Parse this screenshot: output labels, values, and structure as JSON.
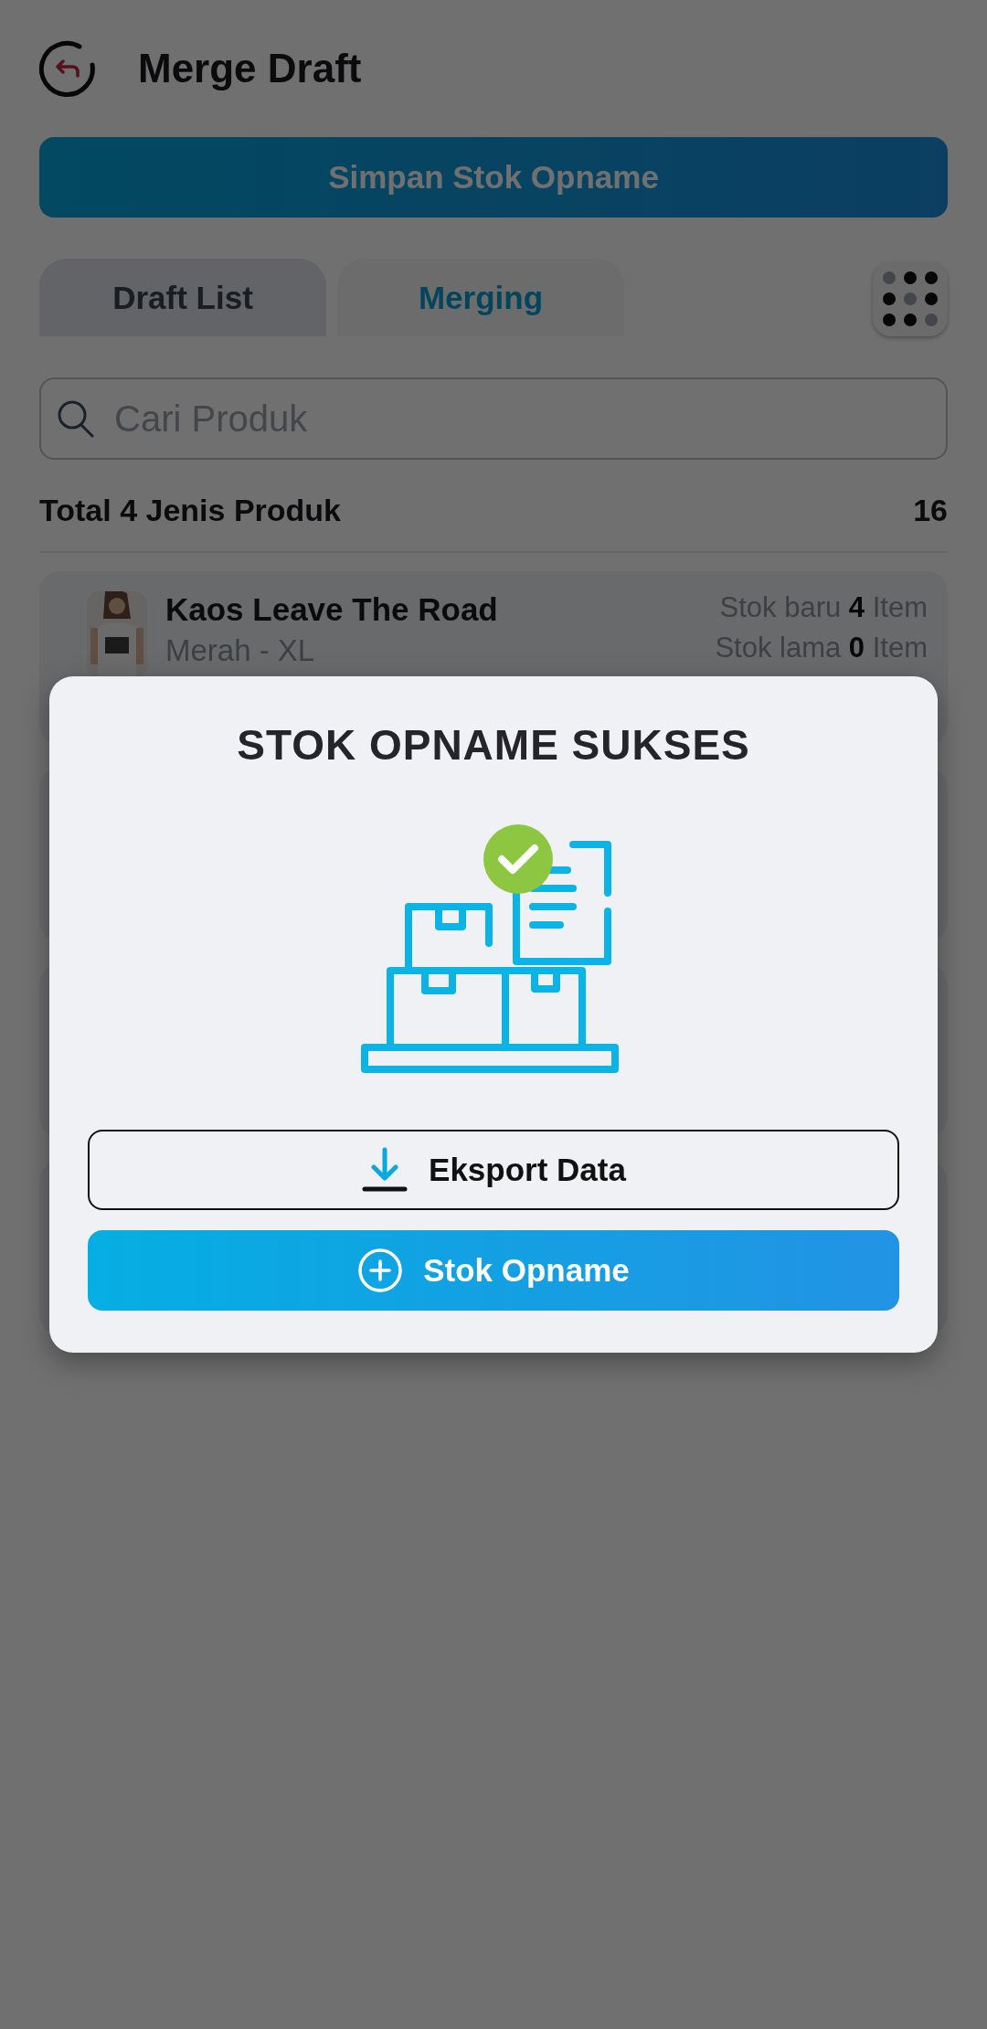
{
  "header": {
    "title": "Merge Draft"
  },
  "save_button": "Simpan Stok Opname",
  "tabs": [
    {
      "label": "Draft List",
      "selected": false
    },
    {
      "label": "Merging",
      "selected": true
    }
  ],
  "search": {
    "placeholder": "Cari Produk"
  },
  "summary": {
    "label": "Total 4 Jenis Produk",
    "count": "16"
  },
  "products": [
    {
      "kind": "item",
      "name": "Kaos Leave The Road",
      "variant": "Merah - XL",
      "new_stock": "Stok baru **4** Item",
      "old_stock": "Stok lama **0** Item"
    },
    {
      "kind": "covered"
    },
    {
      "kind": "covered"
    },
    {
      "kind": "covered"
    }
  ],
  "dialog": {
    "title": "STOK OPNAME SUKSES",
    "buttons": [
      {
        "kind": "outline",
        "label": "Eksport Data"
      },
      {
        "kind": "primary",
        "label": "Stok Opname"
      }
    ]
  }
}
